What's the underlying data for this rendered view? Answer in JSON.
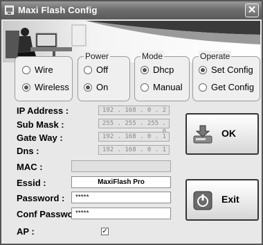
{
  "window": {
    "title": "Maxi Flash Config",
    "close_label": "✕"
  },
  "power": {
    "label": "Power",
    "options": [
      {
        "label": "Off",
        "checked": false
      },
      {
        "label": "On",
        "checked": true
      }
    ]
  },
  "mode": {
    "label": "Mode",
    "options": [
      {
        "label": "Dhcp",
        "checked": true
      },
      {
        "label": "Manual",
        "checked": false
      }
    ]
  },
  "operate": {
    "label": "Operate",
    "options": [
      {
        "label": "Set Config",
        "checked": true
      },
      {
        "label": "Get Config",
        "checked": false
      }
    ]
  },
  "connection": {
    "options": [
      {
        "label": "Wire",
        "checked": false
      },
      {
        "label": "Wireless",
        "checked": true
      }
    ]
  },
  "fields": {
    "ip_address": {
      "label": "IP Address :",
      "value": "192 . 168 .   0   .   2"
    },
    "sub_mask": {
      "label": "Sub Mask :",
      "value": "255 . 255 . 255 .   0"
    },
    "gate_way": {
      "label": "Gate Way :",
      "value": "192 . 168 .   0   .   1"
    },
    "dns": {
      "label": "Dns :",
      "value": "192 . 168 .   0   .   1"
    },
    "mac": {
      "label": "MAC :",
      "value": ""
    },
    "essid": {
      "label": "Essid :",
      "value": "MaxiFlash Pro"
    },
    "password": {
      "label": "Password :",
      "value": "*****"
    },
    "conf_password": {
      "label": "Conf Password :",
      "value": "*****"
    },
    "ap": {
      "label": "AP :",
      "checked": true,
      "mark": "✓"
    }
  },
  "buttons": {
    "ok_label": "OK",
    "exit_label": "Exit"
  }
}
